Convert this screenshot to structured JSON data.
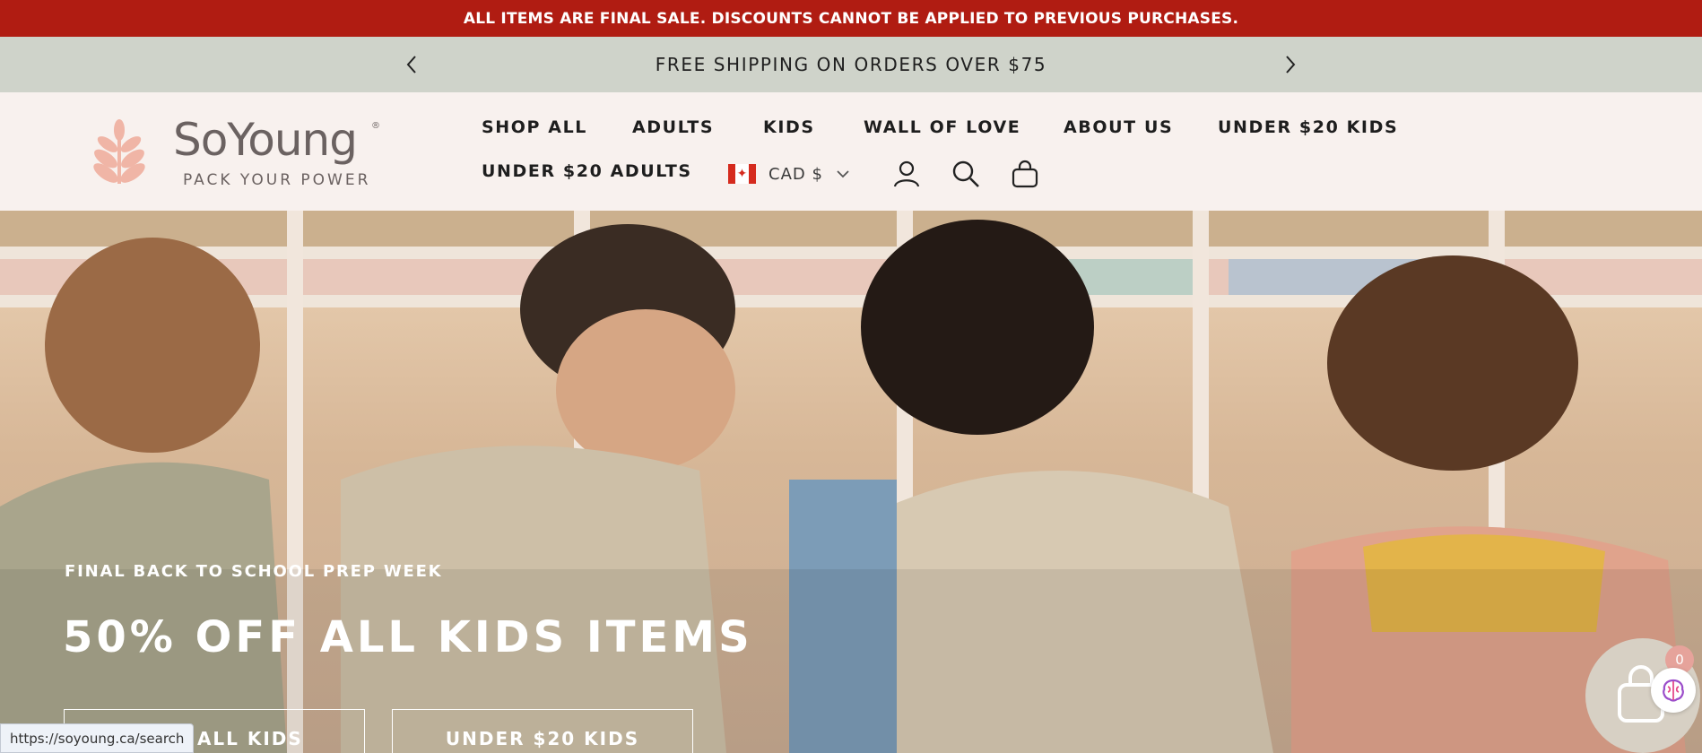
{
  "promo_bar": {
    "text": "ALL ITEMS ARE FINAL SALE. DISCOUNTS CANNOT BE APPLIED TO PREVIOUS PURCHASES."
  },
  "announcement": {
    "text": "FREE SHIPPING ON ORDERS OVER $75",
    "prev_icon": "chevron-left-icon",
    "next_icon": "chevron-right-icon"
  },
  "logo": {
    "name": "SoYoung",
    "registered": "®",
    "tagline": "PACK YOUR POWER"
  },
  "nav": {
    "items": [
      {
        "label": "SHOP ALL"
      },
      {
        "label": "ADULTS"
      },
      {
        "label": "KIDS"
      },
      {
        "label": "WALL OF LOVE"
      },
      {
        "label": "ABOUT US"
      },
      {
        "label": "UNDER $20 KIDS"
      },
      {
        "label": "UNDER $20 ADULTS"
      }
    ]
  },
  "currency": {
    "label": "CAD $",
    "flag": "canada-flag-icon"
  },
  "header_icons": [
    "account-icon",
    "search-icon",
    "cart-bag-icon"
  ],
  "hero": {
    "eyebrow": "FINAL BACK TO SCHOOL PREP WEEK",
    "title": "50% OFF ALL KIDS ITEMS",
    "buttons": [
      {
        "label": "SHOP ALL KIDS"
      },
      {
        "label": "UNDER $20 KIDS"
      }
    ]
  },
  "status_bar": {
    "url": "https://soyoung.ca/search"
  },
  "cart_widget": {
    "count": "0"
  },
  "colors": {
    "promo_red": "#b01c12",
    "announcement_sage": "#cfd3ca",
    "header_bg": "#f8f1ee",
    "logo_pink": "#f0b5a6"
  }
}
